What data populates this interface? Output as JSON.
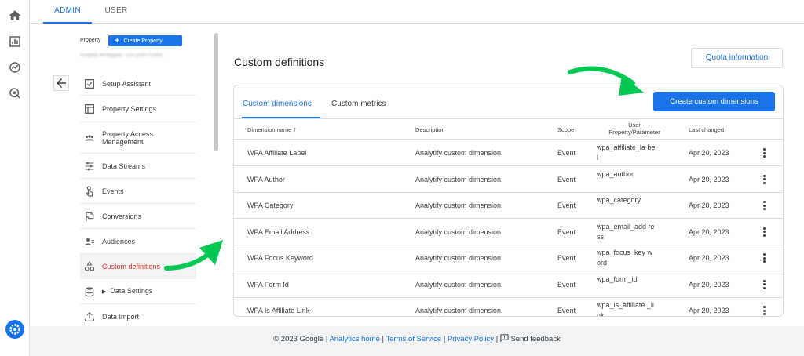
{
  "top_tabs": [
    {
      "label": "ADMIN"
    },
    {
      "label": "USER"
    }
  ],
  "property": {
    "label": "Property",
    "create_label": "Create Property",
    "name": "Analytify-WPB/gada - Ecn (338771493)"
  },
  "nav": [
    {
      "label": "Setup Assistant",
      "icon": "checkbox-icon"
    },
    {
      "label": "Property Settings",
      "icon": "layout-icon"
    },
    {
      "label": "Property Access Management",
      "icon": "group-icon"
    },
    {
      "label": "Data Streams",
      "icon": "streams-icon"
    },
    {
      "label": "Events",
      "icon": "touch-icon"
    },
    {
      "label": "Conversions",
      "icon": "flag-icon"
    },
    {
      "label": "Audiences",
      "icon": "audience-icon"
    },
    {
      "label": "Custom definitions",
      "icon": "shapes-icon",
      "active": true
    },
    {
      "label": "Data Settings",
      "icon": "database-icon"
    },
    {
      "label": "Data Import",
      "icon": "upload-icon"
    }
  ],
  "page_title": "Custom definitions",
  "quota_label": "Quota information",
  "card": {
    "tabs": [
      {
        "label": "Custom dimensions",
        "active": true
      },
      {
        "label": "Custom metrics"
      }
    ],
    "create_label": "Create custom dimensions",
    "columns": {
      "name": "Dimension name",
      "description": "Description",
      "scope": "Scope",
      "user_property": "User Property/Parameter",
      "last_changed": "Last changed"
    },
    "rows": [
      {
        "name": "WPA Affiliate Label",
        "description": "Analytify custom dimension.",
        "scope": "Event",
        "param": "wpa_affiliate_la bel",
        "changed": "Apr 20, 2023"
      },
      {
        "name": "WPA Author",
        "description": "Analytify custom dimension.",
        "scope": "Event",
        "param": "wpa_author",
        "changed": "Apr 20, 2023"
      },
      {
        "name": "WPA Category",
        "description": "Analytify custom dimension.",
        "scope": "Event",
        "param": "wpa_category",
        "changed": "Apr 20, 2023"
      },
      {
        "name": "WPA Email Address",
        "description": "Analytify custom dimension.",
        "scope": "Event",
        "param": "wpa_email_add ress",
        "changed": "Apr 20, 2023"
      },
      {
        "name": "WPA Focus Keyword",
        "description": "Analytify custom dimension.",
        "scope": "Event",
        "param": "wpa_focus_key word",
        "changed": "Apr 20, 2023"
      },
      {
        "name": "WPA Form Id",
        "description": "Analytify custom dimension.",
        "scope": "Event",
        "param": "wpa_form_id",
        "changed": "Apr 20, 2023"
      },
      {
        "name": "WPA Is Affiliate Link",
        "description": "Analytify custom dimension.",
        "scope": "Event",
        "param": "wpa_is_affiliate _link",
        "changed": "Apr 20, 2023"
      }
    ]
  },
  "footer": {
    "copyright": "© 2023 Google |",
    "analytics_home": "Analytics home",
    "terms": "Terms of Service",
    "privacy": "Privacy Policy",
    "feedback": "Send feedback",
    "sep": "|"
  },
  "colors": {
    "accent": "#1a73e8",
    "active_nav": "#d93025",
    "annotation_arrow": "#00c853"
  }
}
